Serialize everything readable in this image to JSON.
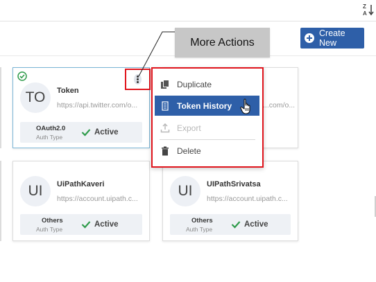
{
  "toolbar": {
    "sort_icon": "sort-za-icon",
    "create_label": "Create New"
  },
  "cards": [
    {
      "avatar": "TO",
      "name": "Token",
      "url": "https://api.twitter.com/o...",
      "auth_type": "OAuth2.0",
      "auth_label": "Auth Type",
      "status": "Active",
      "selected": true
    },
    {
      "avatar": "",
      "name": "",
      "url": "...com/o...",
      "auth_type": "",
      "auth_label": "",
      "status": ""
    },
    {
      "avatar": "UI",
      "name": "UiPathKaveri",
      "url": "https://account.uipath.c...",
      "auth_type": "Others",
      "auth_label": "Auth Type",
      "status": "Active"
    },
    {
      "avatar": "UI",
      "name": "UIPathSrivatsa",
      "url": "https://account.uipath.c...",
      "auth_type": "Others",
      "auth_label": "Auth Type",
      "status": "Active"
    }
  ],
  "menu": {
    "items": [
      {
        "label": "Duplicate",
        "icon": "duplicate-icon",
        "state": "normal"
      },
      {
        "label": "Token History",
        "icon": "history-icon",
        "state": "active"
      },
      {
        "label": "Export",
        "icon": "export-icon",
        "state": "disabled"
      },
      {
        "label": "Delete",
        "icon": "trash-icon",
        "state": "normal"
      }
    ]
  },
  "callout": {
    "label": "More Actions"
  },
  "colors": {
    "accent": "#2e5fa8",
    "active_green": "#2e9b4a",
    "highlight_red": "#e0141c",
    "callout_bg": "#c7c7c7"
  }
}
